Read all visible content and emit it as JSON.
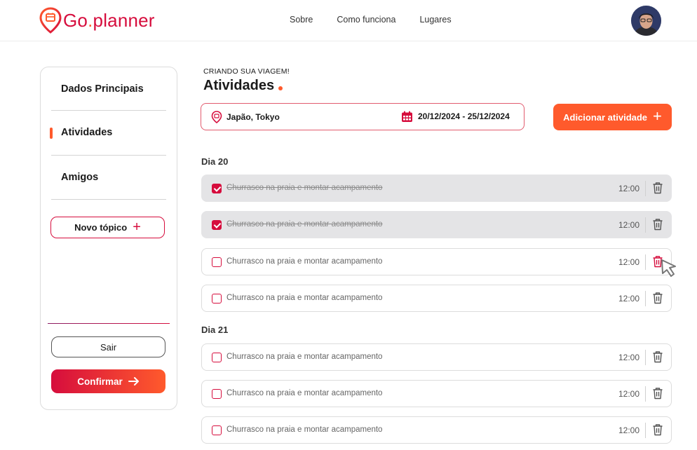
{
  "header": {
    "logo_text": "Go",
    "logo_dot": ".",
    "logo_text2": "planner",
    "nav": [
      "Sobre",
      "Como funciona",
      "Lugares"
    ]
  },
  "sidebar": {
    "items": [
      {
        "label": "Dados Principais"
      },
      {
        "label": "Atividades"
      },
      {
        "label": "Amigos"
      }
    ],
    "new_topic": "Novo tópico",
    "logout": "Sair",
    "confirm": "Confirmar"
  },
  "main": {
    "eyebrow": "CRIANDO SUA VIAGEM!",
    "title": "Atividades",
    "location": "Japão, Tokyo",
    "dates": "20/12/2024 - 25/12/2024",
    "add_button": "Adicionar atividade",
    "days": [
      {
        "label": "Dia 20",
        "activities": [
          {
            "text": "Churrasco na praia e montar acampamento",
            "time": "12:00",
            "done": true
          },
          {
            "text": "Churrasco na praia e montar acampamento",
            "time": "12:00",
            "done": true
          },
          {
            "text": "Churrasco na praia e montar acampamento",
            "time": "12:00",
            "done": false
          },
          {
            "text": "Churrasco na praia e montar acampamento",
            "time": "12:00",
            "done": false
          }
        ]
      },
      {
        "label": "Dia 21",
        "activities": [
          {
            "text": "Churrasco na praia e montar acampamento",
            "time": "12:00",
            "done": false
          },
          {
            "text": "Churrasco na praia e montar acampamento",
            "time": "12:00",
            "done": false
          },
          {
            "text": "Churrasco na praia e montar acampamento",
            "time": "12:00",
            "done": false
          }
        ]
      }
    ]
  },
  "colors": {
    "brand_red": "#d60d3d",
    "brand_orange": "#ff5a2c",
    "done_row_bg": "#e4e4e6"
  },
  "icons": [
    "location-pin-icon",
    "calendar-icon",
    "plus-icon",
    "arrow-right-icon",
    "trash-icon",
    "cursor-pointer-icon"
  ]
}
